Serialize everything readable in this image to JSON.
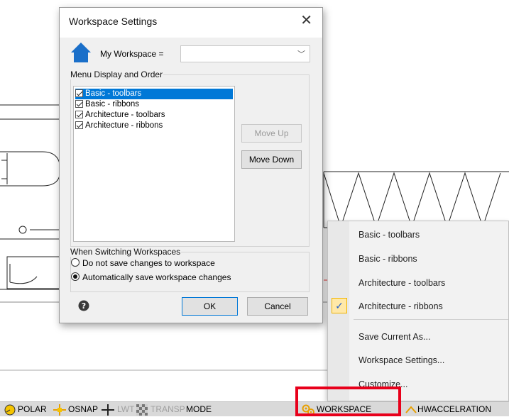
{
  "dialog": {
    "title": "Workspace Settings",
    "close_glyph": "✕",
    "my_workspace_label": "My Workspace =",
    "my_workspace_value": "",
    "menu_group_label": "Menu Display and Order",
    "items": [
      {
        "label": "Basic - toolbars",
        "checked": true,
        "selected": true
      },
      {
        "label": "Basic - ribbons",
        "checked": true,
        "selected": false
      },
      {
        "label": "Architecture - toolbars",
        "checked": true,
        "selected": false
      },
      {
        "label": "Architecture - ribbons",
        "checked": true,
        "selected": false
      }
    ],
    "move_up_label": "Move Up",
    "move_down_label": "Move Down",
    "switching_group_label": "When Switching Workspaces",
    "radio_no_save": "Do not save changes to workspace",
    "radio_auto_save": "Automatically save workspace changes",
    "radio_selected": "auto_save",
    "ok_label": "OK",
    "cancel_label": "Cancel",
    "help_icon": "question-circle-icon",
    "home_icon": "house-icon"
  },
  "context_menu": {
    "workspaces": [
      "Basic - toolbars",
      "Basic - ribbons",
      "Architecture - toolbars",
      "Architecture - ribbons"
    ],
    "checked_index": 3,
    "check_glyph": "✓",
    "save_current_as": "Save Current As...",
    "workspace_settings": "Workspace Settings...",
    "customize": "Customize..."
  },
  "status_bar": {
    "polar": "POLAR",
    "osnap": "OSNAP",
    "lwt": "LWT",
    "transp": "TRANSP",
    "mode": "MODE",
    "workspace": "WORKSPACE",
    "hwaccel": "HWACCELRATION"
  },
  "colors": {
    "selection_blue": "#0078d7",
    "highlight_red": "#e8001b",
    "house_blue": "#1a6fc9",
    "polar_yellow": "#f5c400"
  }
}
